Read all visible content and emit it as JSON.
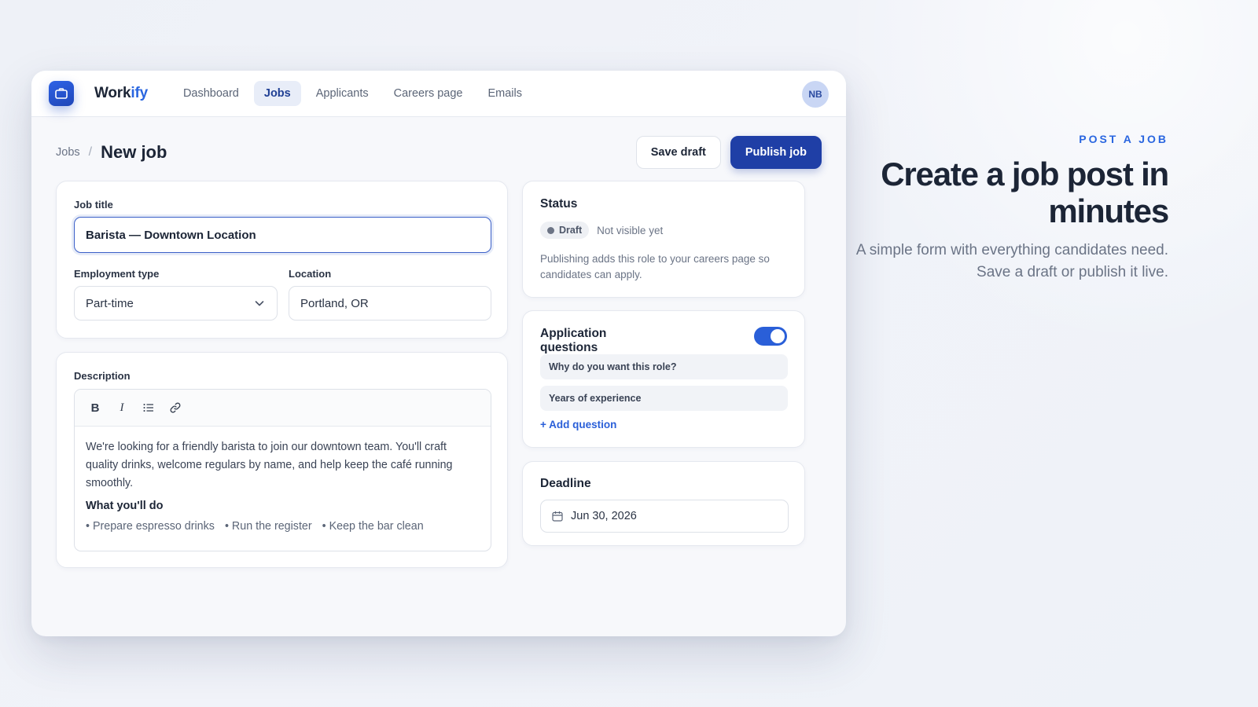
{
  "app": {
    "brand_main": "Work",
    "brand_accent": "ify",
    "nav": [
      {
        "label": "Dashboard",
        "active": false
      },
      {
        "label": "Jobs",
        "active": true
      },
      {
        "label": "Applicants",
        "active": false
      },
      {
        "label": "Careers page",
        "active": false
      },
      {
        "label": "Emails",
        "active": false
      }
    ],
    "avatar_initials": "NB",
    "accent_color": "#2a66e0",
    "primary_button_color": "#1f3fa6"
  },
  "page": {
    "breadcrumb_parent": "Jobs",
    "breadcrumb_separator": "/",
    "title": "New job",
    "save_draft_label": "Save draft",
    "publish_label": "Publish job"
  },
  "form": {
    "job_title_label": "Job title",
    "job_title_value": "Barista — Downtown Location",
    "employment_type_label": "Employment type",
    "employment_type_value": "Part-time",
    "location_label": "Location",
    "location_value": "Portland, OR",
    "description_label": "Description",
    "toolbar": {
      "bold": "B",
      "italic": "I"
    },
    "description_text": "We're looking for a friendly barista to join our downtown team. You'll craft quality drinks, welcome regulars by name, and help keep the café running smoothly.",
    "duties_heading": "What you'll do",
    "duties": [
      "• Prepare espresso drinks",
      "• Run the register",
      "• Keep the bar clean"
    ]
  },
  "status": {
    "title": "Status",
    "badge": "Draft",
    "visibility": "Not visible yet",
    "note": "Publishing adds this role to your careers page so candidates can apply."
  },
  "questions": {
    "title": "Application questions",
    "enabled": true,
    "items": [
      "Why do you want this role?",
      "Years of experience"
    ],
    "add_label": "+ Add question"
  },
  "deadline": {
    "title": "Deadline",
    "value": "Jun 30, 2026"
  },
  "marketing": {
    "eyebrow": "POST A JOB",
    "title": "Create a job post in minutes",
    "subtitle": "A simple form with everything candidates need. Save a draft or publish it live."
  }
}
